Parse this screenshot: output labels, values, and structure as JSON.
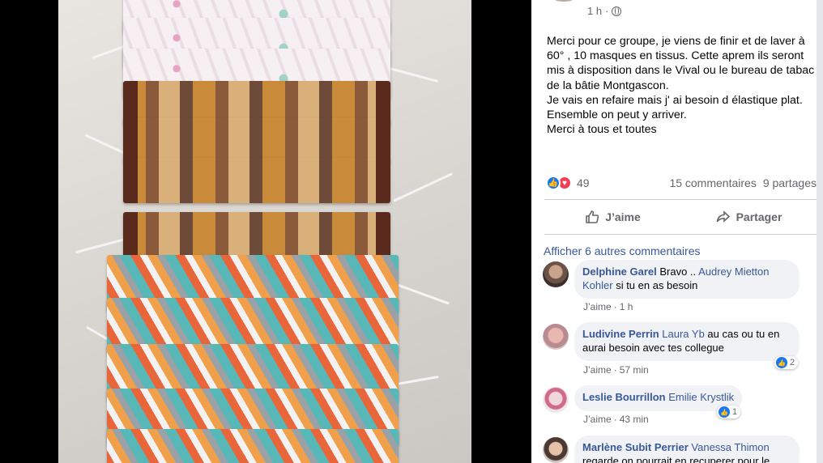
{
  "post": {
    "time": "1 h",
    "text": [
      "Merci pour ce groupe, je viens de finir et de laver à 60° , 10 masques en tissus. Cette aprem ils seront mis à disposition dans le Vival ou le bureau de tabac de la bâtie Montgascon.",
      "Je vais en refaire mais j' ai besoin d élastique plat.",
      "Ensemble on peut y arriver.",
      "Merci à tous et toutes"
    ],
    "reaction_count": "49",
    "comments_count": "15 commentaires",
    "shares_count": "9 partages",
    "like_label": "J’aime",
    "share_label": "Partager",
    "more_comments": "Afficher 6 autres commentaires"
  },
  "comments": [
    {
      "author": "Delphine Garel",
      "text_before": " Bravo .. ",
      "tag": "Audrey Mietton Kohler",
      "text_after": " si tu en as besoin",
      "like": "J’aime",
      "sep": "·",
      "time": "1 h",
      "reactions": ""
    },
    {
      "author": "Ludivine Perrin",
      "text_before": " ",
      "tag": "Laura Yb",
      "text_after": " au cas ou tu en aurai besoin avec tes collegue",
      "like": "J’aime",
      "sep": "·",
      "time": "57 min",
      "reactions": "2"
    },
    {
      "author": "Leslie Bourrillon",
      "text_before": " ",
      "tag": "Emilie Krystlik",
      "text_after": "",
      "like": "J’aime",
      "sep": "·",
      "time": "43 min",
      "reactions": "1"
    },
    {
      "author": "Marlène Subit Perrier",
      "text_before": " ",
      "tag": "Vanessa Thimon",
      "text_after": " regarde on pourrait en recuperer pour le",
      "like": "",
      "sep": "",
      "time": "",
      "reactions": ""
    }
  ],
  "colors": {
    "link": "#385898",
    "like_blue": "#1877f2",
    "love_red": "#f33e58",
    "muted": "#65676b"
  },
  "icons": [
    "globe-icon",
    "like-icon",
    "love-icon",
    "thumbs-up-icon",
    "share-arrow-icon"
  ]
}
